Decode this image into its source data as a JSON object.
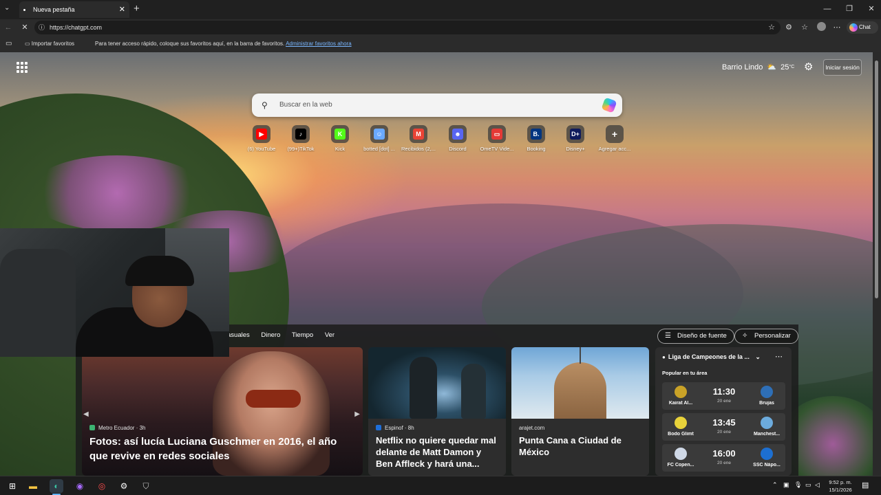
{
  "browser": {
    "tab_title": "Nueva pestaña",
    "url": "https://chatgpt.com",
    "chat_label": "Chat",
    "favorites_bar": {
      "import_label": "Importar favoritos",
      "hint": "Para tener acceso rápido, coloque sus favoritos aquí, en la barra de favoritos.",
      "manage_link": "Administrar favoritos ahora"
    }
  },
  "newtab": {
    "location": "Barrio Lindo",
    "temperature": "25",
    "temperature_unit": "°C",
    "signin_label": "Iniciar sesión",
    "search_placeholder": "Buscar en la web",
    "quick_links": [
      {
        "label": "(6) YouTube",
        "icon": "youtube-icon",
        "color": "#ff0000"
      },
      {
        "label": "(99+)TikTok",
        "icon": "tiktok-icon",
        "color": "#000000"
      },
      {
        "label": "Kick",
        "icon": "kick-icon",
        "color": "#53fc18"
      },
      {
        "label": "botted [dot] ...",
        "icon": "robot-icon",
        "color": "#6aa9ff"
      },
      {
        "label": "Recibidos (2,...",
        "icon": "gmail-icon",
        "color": "#ea4335"
      },
      {
        "label": "Discord",
        "icon": "discord-icon",
        "color": "#5865f2"
      },
      {
        "label": "OmeTV Vide...",
        "icon": "ometv-icon",
        "color": "#e53935"
      },
      {
        "label": "Booking",
        "icon": "booking-icon",
        "color": "#003580"
      },
      {
        "label": "Disney+",
        "icon": "disney-icon",
        "color": "#0e1a5c"
      },
      {
        "label": "Agregar acc...",
        "icon": "plus-icon",
        "color": "#555555"
      }
    ],
    "nav_items": [
      "asuales",
      "Dinero",
      "Tiempo",
      "Ver"
    ],
    "font_design_label": "Diseño de fuente",
    "customize_label": "Personalizar",
    "cards": [
      {
        "source": "Metro Ecuador",
        "age": "3h",
        "title": "Fotos: así lucía Luciana Guschmer en 2016, el año que revive en redes sociales"
      },
      {
        "source": "Espinof",
        "age": "8h",
        "title": "Netflix no quiere quedar mal delante de Matt Damon y Ben Affleck y hará una..."
      },
      {
        "source": "arajet.com",
        "age": "",
        "title": "Punta Cana a Ciudad de México"
      }
    ],
    "sports": {
      "league": "Liga de Campeones de la ...",
      "subtitle": "Popular en tu área",
      "matches": [
        {
          "home": "Kairat Al...",
          "away": "Brujas",
          "time": "11:30",
          "date": "20 ene"
        },
        {
          "home": "Bodo Glimt",
          "away": "Manchest...",
          "time": "13:45",
          "date": "20 ene"
        },
        {
          "home": "FC Copen...",
          "away": "SSC Nápo...",
          "time": "16:00",
          "date": "20 ene"
        }
      ]
    }
  },
  "taskbar": {
    "time": "9:52 p. m.",
    "date": "15/1/2026"
  }
}
